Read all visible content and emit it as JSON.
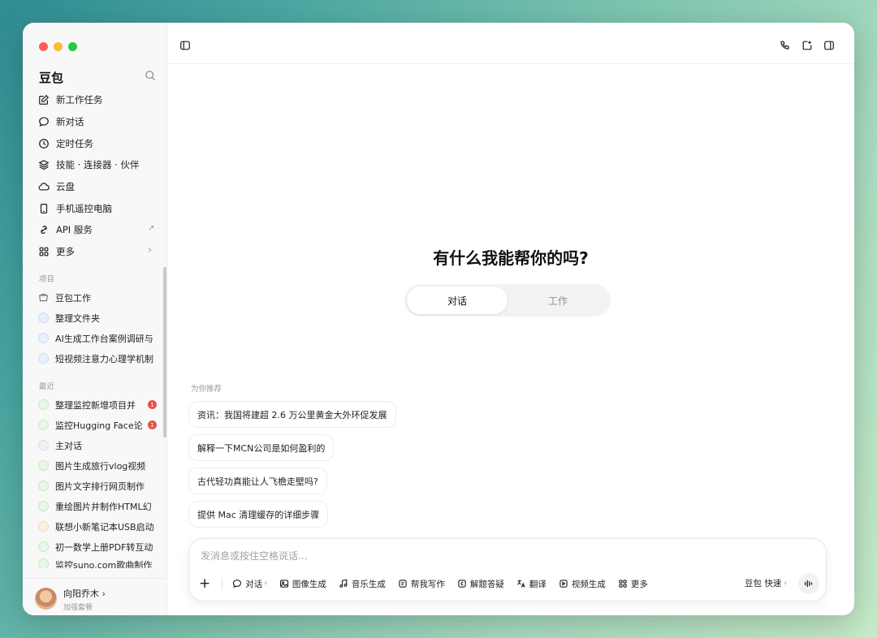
{
  "sidebar": {
    "brand": "豆包",
    "nav": [
      {
        "label": "新工作任务",
        "icon": "edit-icon"
      },
      {
        "label": "新对话",
        "icon": "chat-bubble-icon"
      },
      {
        "label": "定时任务",
        "icon": "clock-icon"
      },
      {
        "label": "技能 · 连接器 · 伙伴",
        "icon": "layers-icon"
      },
      {
        "label": "云盘",
        "icon": "cloud-icon"
      },
      {
        "label": "手机遥控电脑",
        "icon": "phone-icon"
      },
      {
        "label": "API 服务",
        "icon": "api-icon",
        "trail": "↗"
      },
      {
        "label": "更多",
        "icon": "grid-icon",
        "trail": "›"
      }
    ],
    "projects_label": "项目",
    "projects": [
      "豆包工作",
      "整理文件夹",
      "AI生成工作台案例调研与",
      "短视频注意力心理学机制"
    ],
    "recent_label": "最近",
    "recent": [
      {
        "label": "整理监控新增项目并",
        "badge": "1"
      },
      {
        "label": "监控Hugging Face论",
        "badge": "1"
      },
      {
        "label": "主对话"
      },
      {
        "label": "图片生成旅行vlog视频"
      },
      {
        "label": "图片文字排行网页制作"
      },
      {
        "label": "重绘图片并制作HTML幻"
      },
      {
        "label": "联想小新笔记本USB启动"
      },
      {
        "label": "初一数学上册PDF转互动"
      },
      {
        "label": "监控suno.com歌曲制作"
      }
    ],
    "user": {
      "name": "向阳乔木 ›",
      "plan": "加强套餐"
    }
  },
  "main": {
    "greeting": "有什么我能帮你的吗?",
    "modes": {
      "active": "对话",
      "other": "工作"
    },
    "recommend_label": "为你推荐",
    "suggestions": [
      "资讯：我国将建超 2.6 万公里黄金大外环促发展",
      "解释一下MCN公司是如何盈利的",
      "古代轻功真能让人飞檐走壁吗?",
      "提供 Mac 清理缓存的详细步骤"
    ],
    "composer": {
      "placeholder": "发消息或按住空格说话...",
      "plus": "+",
      "tools": [
        {
          "label": "对话",
          "icon": "chat-bubble-icon",
          "chevron": "›"
        },
        {
          "label": "图像生成",
          "icon": "image-icon"
        },
        {
          "label": "音乐生成",
          "icon": "music-icon"
        },
        {
          "label": "帮我写作",
          "icon": "write-icon"
        },
        {
          "label": "解题答疑",
          "icon": "solve-icon"
        },
        {
          "label": "翻译",
          "icon": "translate-icon"
        },
        {
          "label": "视频生成",
          "icon": "video-icon"
        },
        {
          "label": "更多",
          "icon": "grid-icon"
        }
      ],
      "model": "豆包 快速",
      "model_chevron": "›"
    }
  },
  "colors": {
    "badge": "#e5534b",
    "accent_bg": "#f3f3f5"
  }
}
